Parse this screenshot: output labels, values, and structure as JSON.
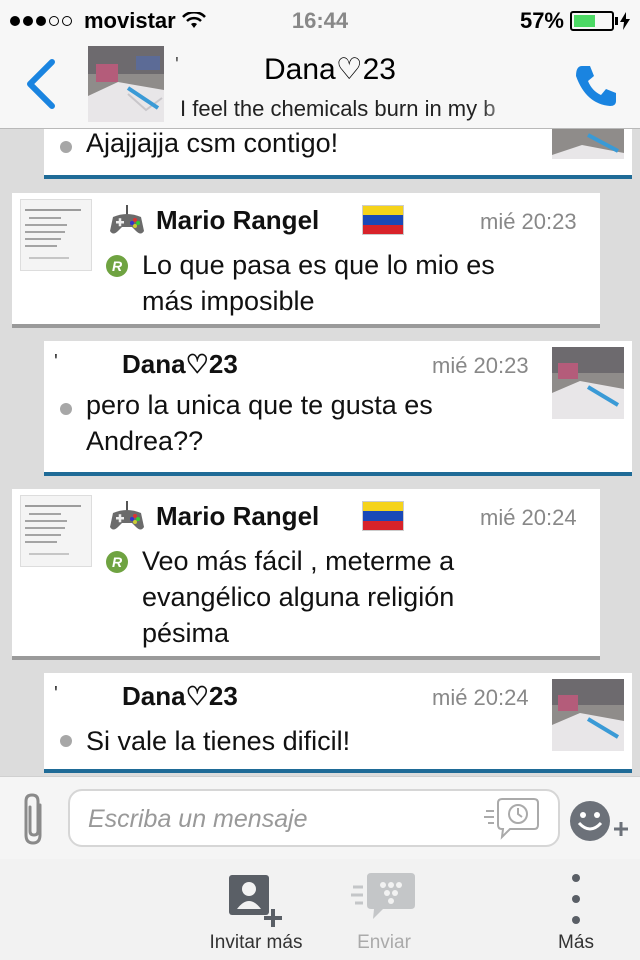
{
  "status_bar": {
    "carrier": "movistar",
    "time": "16:44",
    "battery": "57%"
  },
  "header": {
    "title": "Dana♡23",
    "subtitle": "I feel the chemicals burn in my b",
    "partial_mark": "'"
  },
  "messages": [
    {
      "sender": "",
      "time": "",
      "text": "Ajajjajja csm contigo!",
      "type": "own"
    },
    {
      "sender": "Mario Rangel",
      "time": "mié 20:23",
      "text": [
        "Lo que pasa es que lo mio es",
        "más imposible"
      ],
      "type": "other",
      "badge": "R"
    },
    {
      "sender": "Dana♡23",
      "time": "mié 20:23",
      "text": [
        "pero la unica que te gusta es",
        "Andrea??"
      ],
      "type": "own",
      "mark": "'"
    },
    {
      "sender": "Mario Rangel",
      "time": "mié 20:24",
      "text": [
        "Veo más fácil , meterme a",
        "evangélico alguna religión",
        "pésima"
      ],
      "type": "other",
      "badge": "R"
    },
    {
      "sender": "Dana♡23",
      "time": "mié 20:24",
      "text": "Si vale la tienes dificil!",
      "type": "own",
      "mark": "'"
    }
  ],
  "composer": {
    "placeholder": "Escriba un mensaje"
  },
  "tabs": [
    {
      "label": "Invitar más",
      "icon": "invite-icon"
    },
    {
      "label": "Enviar",
      "icon": "send-icon"
    },
    {
      "label": "Más",
      "icon": "more-icon"
    }
  ],
  "colors": {
    "accent": "#1a84e0",
    "own_rule": "#1f6b97",
    "other_rule": "#9a9a9a",
    "badge": "#6fa341"
  }
}
